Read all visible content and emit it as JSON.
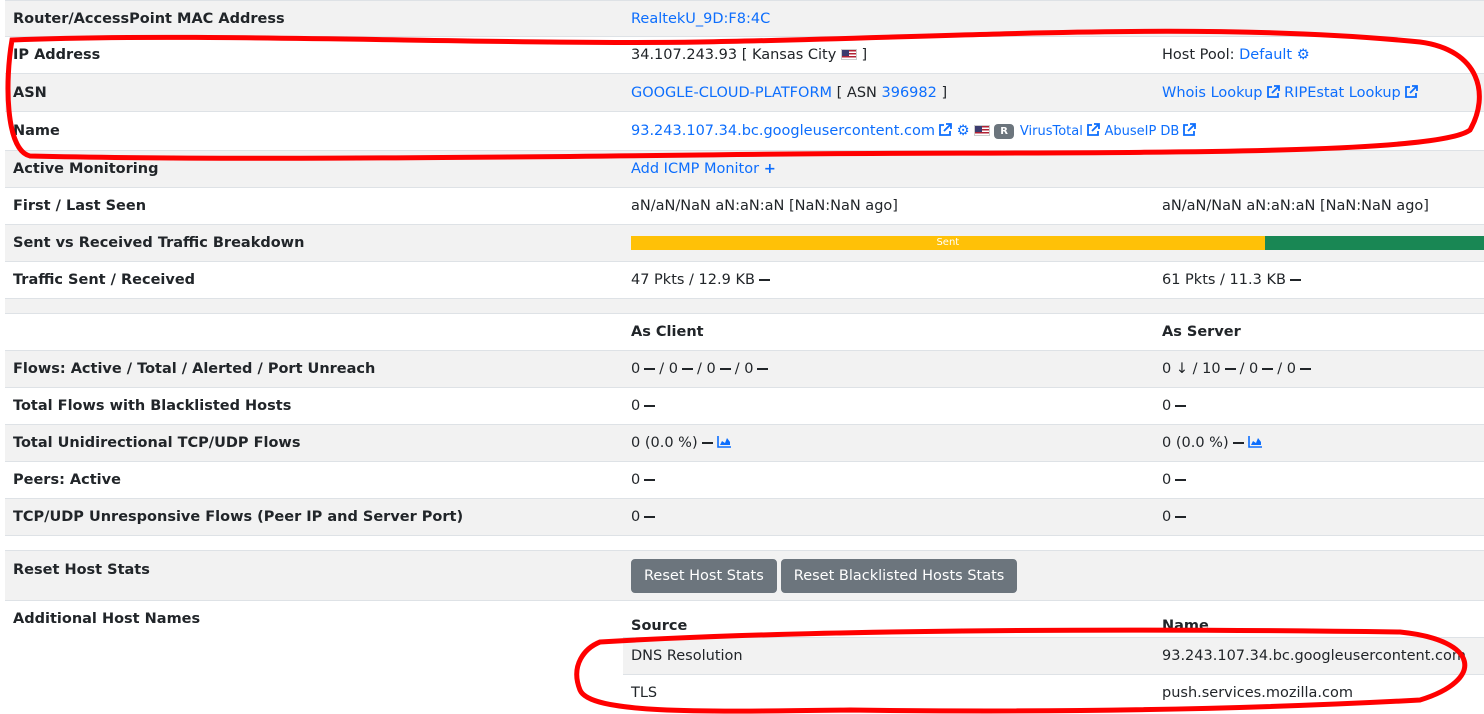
{
  "rows": {
    "mac": {
      "label": "Router/AccessPoint MAC Address",
      "value": "RealtekU_9D:F8:4C"
    },
    "ip": {
      "label": "IP Address",
      "value": "34.107.243.93 [ Kansas City",
      "close": "]",
      "pool_label": "Host Pool: ",
      "pool_value": "Default"
    },
    "asn": {
      "label": "ASN",
      "value": "GOOGLE-CLOUD-PLATFORM",
      "mid": "[ ASN ",
      "num": "396982",
      "close": "]",
      "whois": "Whois Lookup",
      "ripe": "RIPEstat Lookup"
    },
    "name": {
      "label": "Name",
      "value": "93.243.107.34.bc.googleusercontent.com",
      "badge": "R",
      "vt": "VirusTotal",
      "abuse": "AbuseIP DB"
    },
    "monitor": {
      "label": "Active Monitoring",
      "value": "Add ICMP Monitor"
    },
    "seen": {
      "label": "First / Last Seen",
      "first": "aN/aN/NaN aN:aN:aN [NaN:NaN ago]",
      "last": "aN/aN/NaN aN:aN:aN [NaN:NaN ago]"
    },
    "breakdown": {
      "label": "Sent vs Received Traffic Breakdown",
      "sent_label": "Sent",
      "sent_fraction": 0.742
    },
    "traffic": {
      "label": "Traffic Sent / Received",
      "sent": "47 Pkts / 12.9 KB",
      "rcvd": "61 Pkts / 11.3 KB"
    },
    "header": {
      "client": "As Client",
      "server": "As Server"
    },
    "flows": {
      "label": "Flows: Active / Total / Alerted / Port Unreach",
      "client": [
        "0",
        "/ 0",
        "/ 0",
        "/ 0"
      ],
      "server_first": "0",
      "server_rest": [
        "/ 10",
        "/ 0",
        "/ 0"
      ]
    },
    "blacklisted": {
      "label": "Total Flows with Blacklisted Hosts",
      "client": "0",
      "server": "0"
    },
    "unidir": {
      "label": "Total Unidirectional TCP/UDP Flows",
      "client": "0 (0.0 %)",
      "server": "0 (0.0 %)"
    },
    "peers": {
      "label": "Peers: Active",
      "client": "0",
      "server": "0"
    },
    "unresp": {
      "label": "TCP/UDP Unresponsive Flows (Peer IP and Server Port)",
      "client": "0",
      "server": "0"
    },
    "reset": {
      "label": "Reset Host Stats",
      "btn1": "Reset Host Stats",
      "btn2": "Reset Blacklisted Hosts Stats"
    },
    "additional": {
      "label": "Additional Host Names",
      "col_source": "Source",
      "col_name": "Name",
      "entries": [
        {
          "source": "DNS Resolution",
          "name": "93.243.107.34.bc.googleusercontent.com"
        },
        {
          "source": "TLS",
          "name": "push.services.mozilla.com"
        }
      ]
    }
  },
  "colors": {
    "link": "#0d6efd",
    "stripe": "#f2f2f2",
    "button": "#6c757d",
    "sent_bar": "#ffc107",
    "recv_bar": "#198754",
    "annotation": "#ff0000"
  }
}
